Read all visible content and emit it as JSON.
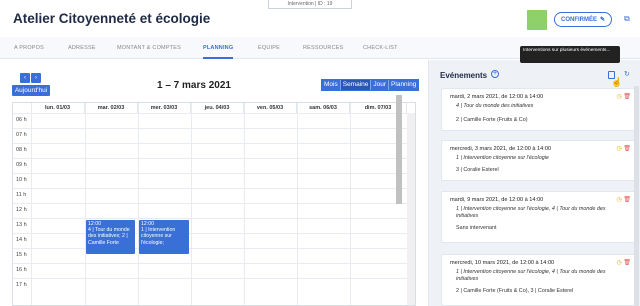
{
  "header": {
    "badge": "Intervention | ID : 19",
    "title": "Atelier Citoyenneté et écologie",
    "confirm_label": "CONFIRMÉE",
    "status_color": "#8ed16b"
  },
  "tabs": [
    "A PROPOS",
    "ADRESSE",
    "MONTANT & COMPTES",
    "PLANNING",
    "EQUIPE",
    "RESSOURCES",
    "CHECK-LIST"
  ],
  "tabs_active": "PLANNING",
  "calendar": {
    "today_label": "Aujourd'hui",
    "range_label": "1 – 7 mars 2021",
    "views": [
      "Mois",
      "Semaine",
      "Jour",
      "Planning"
    ],
    "view_selected": "Semaine",
    "days": [
      "lun. 01/03",
      "mar. 02/03",
      "mer. 03/03",
      "jeu. 04/03",
      "ven. 05/03",
      "sam. 06/03",
      "dim. 07/03"
    ],
    "hours": [
      "06 h",
      "07 h",
      "08 h",
      "09 h",
      "10 h",
      "11 h",
      "12 h",
      "13 h",
      "14 h",
      "15 h",
      "16 h",
      "17 h"
    ],
    "events": [
      {
        "time": "12:00",
        "text": "4 | Tour du monde des initiatives; 2 | Camille Forte"
      },
      {
        "time": "12:00",
        "text": "1 | Intervention citoyenne sur l'écologie;"
      }
    ]
  },
  "sidebar": {
    "title": "Evénements",
    "tooltip": "Interventions sur plusieurs événements...",
    "cards": [
      {
        "date": "mardi, 2 mars 2021, de 12:00 à 14:00",
        "l1": "4 | Tour du monde des initiatives",
        "l2": "2 | Camille Forte (Fruits & Co)"
      },
      {
        "date": "mercredi, 3 mars 2021, de 12:00 à 14:00",
        "l1": "1 | Intervention citoyenne sur l'écologie",
        "l2": "3 | Coralie Esterel"
      },
      {
        "date": "mardi, 9 mars 2021, de 12:00 à 14:00",
        "l1": "1 | Intervention citoyenne sur l'écologie, 4 | Tour du monde des initiatives",
        "l2": "Sans intervenant"
      },
      {
        "date": "mercredi, 10 mars 2021, de 12:00 à 14:00",
        "l1": "1 | Intervention citoyenne sur l'écologie, 4 | Tour du monde des initiatives",
        "l2": "2 | Camille Forte (Fruits & Co), 3 | Coralie Esterel"
      }
    ]
  }
}
